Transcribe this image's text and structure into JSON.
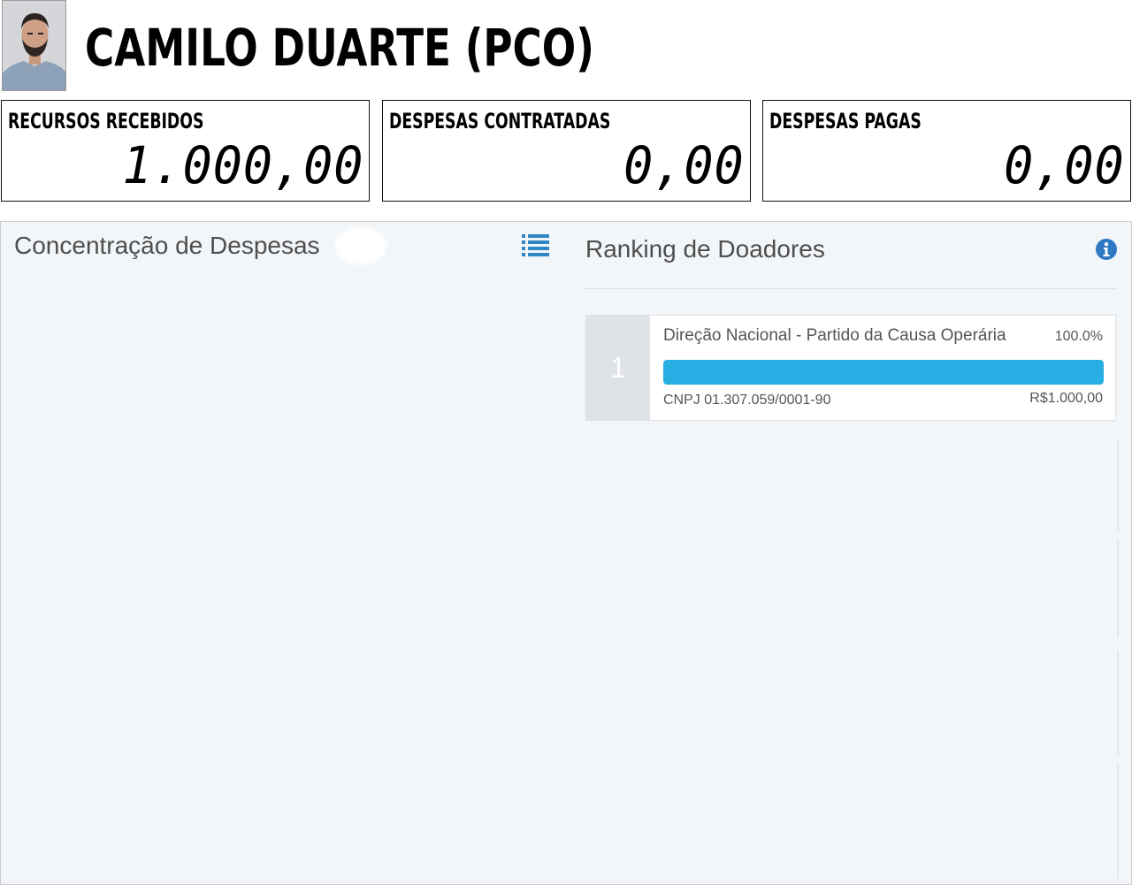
{
  "header": {
    "candidate_name": "CAMILO DUARTE (PCO)"
  },
  "summary": [
    {
      "label": "RECURSOS RECEBIDOS",
      "value": "1.000,00"
    },
    {
      "label": "DESPESAS CONTRATADAS",
      "value": "0,00"
    },
    {
      "label": "DESPESAS PAGAS",
      "value": "0,00"
    }
  ],
  "expenses_panel": {
    "title": "Concentração de Despesas",
    "icon": "list-icon"
  },
  "donors_panel": {
    "title": "Ranking de Doadores",
    "icon": "info-icon",
    "accent_color": "#27aee3",
    "donors": [
      {
        "rank": "1",
        "name": "Direção Nacional - Partido da Causa Operária",
        "percent_label": "100.0%",
        "share": 1.0,
        "cnpj": "CNPJ 01.307.059/0001-90",
        "amount": "R$1.000,00"
      }
    ]
  }
}
